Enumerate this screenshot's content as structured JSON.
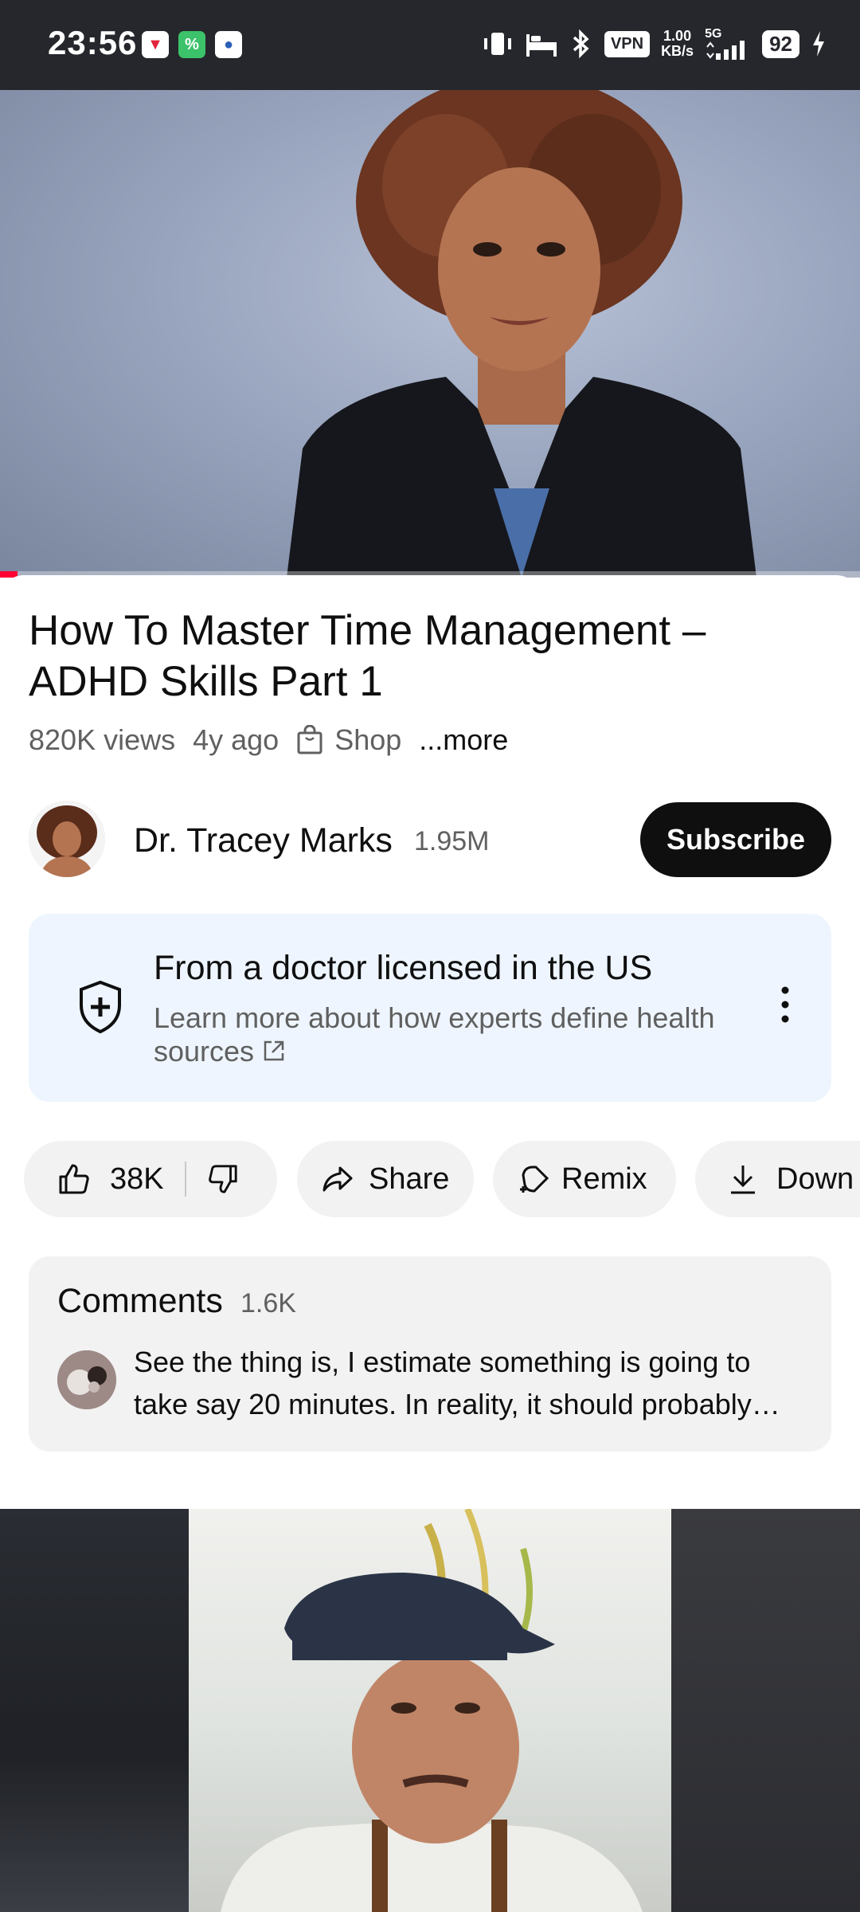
{
  "status_bar": {
    "time": "23:56",
    "vpn": "VPN",
    "speed_value": "1.00",
    "speed_unit": "KB/s",
    "network": "5G",
    "battery": "92"
  },
  "player": {
    "progress_fraction": 0.02,
    "progress_color": "#ff0033"
  },
  "video": {
    "title": "How To Master Time Management – ADHD Skills Part 1",
    "views": "820K views",
    "age": "4y ago",
    "shop_label": "Shop",
    "more_label": "...more"
  },
  "channel": {
    "name": "Dr. Tracey Marks",
    "subscribers": "1.95M",
    "subscribe_label": "Subscribe"
  },
  "health_card": {
    "title": "From a doctor licensed in the US",
    "subtitle": "Learn more about how experts define health sources"
  },
  "actions": {
    "like_count": "38K",
    "share_label": "Share",
    "remix_label": "Remix",
    "download_label": "Down"
  },
  "comments": {
    "title": "Comments",
    "count": "1.6K",
    "top_comment": "See the thing is, I estimate something is going to take say 20 minutes. In reality, it should probably take much longer..."
  },
  "colors": {
    "accent": "#ff0033",
    "subscribe_bg": "#0f0f0f",
    "card_bg": "#eef5fe",
    "pill_bg": "#f2f2f2"
  }
}
